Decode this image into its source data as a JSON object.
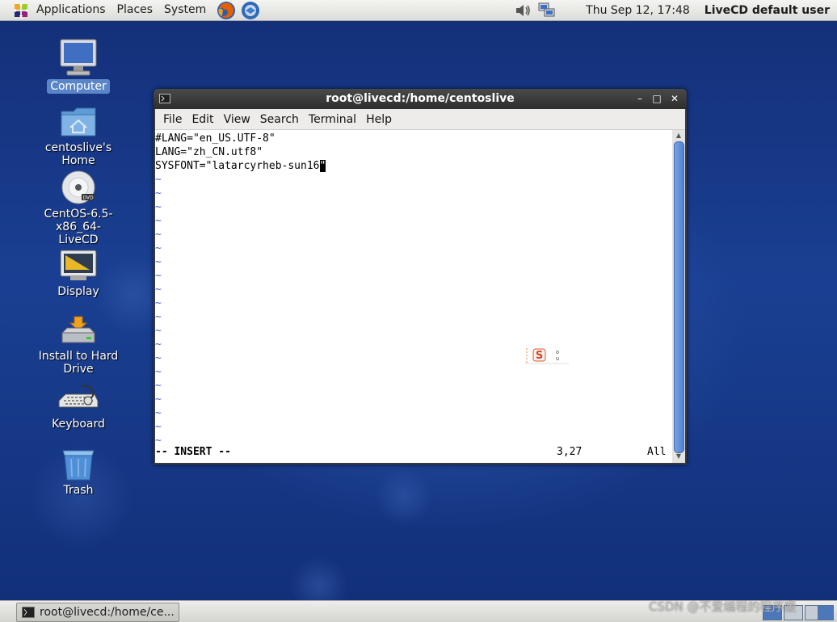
{
  "top_panel": {
    "menus": [
      "Applications",
      "Places",
      "System"
    ],
    "clock": "Thu Sep 12, 17:48",
    "user": "LiveCD default user",
    "launchers": [
      "firefox-icon",
      "thunderbird-icon"
    ],
    "tray": [
      "volume-icon",
      "network-icon"
    ]
  },
  "desktop_icons": [
    {
      "label": "Computer",
      "icon": "computer-icon",
      "selected": true
    },
    {
      "label": "centoslive's Home",
      "icon": "home-folder-icon"
    },
    {
      "label": "CentOS-6.5-x86_64-\nLiveCD",
      "label_line1": "CentOS-6.5-x86_64-",
      "label_line2": "LiveCD",
      "icon": "dvd-icon"
    },
    {
      "label": "Display",
      "icon": "display-icon"
    },
    {
      "label": "Install to Hard Drive",
      "icon": "install-drive-icon"
    },
    {
      "label": "Keyboard",
      "icon": "keyboard-icon"
    },
    {
      "label": "Trash",
      "icon": "trash-icon"
    }
  ],
  "terminal": {
    "title": "root@livecd:/home/centoslive",
    "menus": [
      "File",
      "Edit",
      "View",
      "Search",
      "Terminal",
      "Help"
    ],
    "lines": [
      "#LANG=\"en_US.UTF-8\"",
      "LANG=\"zh_CN.utf8\"",
      "SYSFONT=\"latarcyrheb-sun16"
    ],
    "cursor_char": "\"",
    "tilde": "~",
    "tilde_count": 20,
    "mode": "-- INSERT --",
    "position": "3,27",
    "scroll": "All",
    "wm_buttons": {
      "minimize": "–",
      "maximize": "□",
      "close": "✕"
    }
  },
  "bottom_panel": {
    "task": "root@livecd:/home/ce...",
    "watermark": "CSDN @不爱编程的程序媛"
  },
  "colors": {
    "desktop": "#1a3f92",
    "panel": "#e6e6e3",
    "tilde": "#4a6bd8",
    "scrollbar": "#5b8bd4"
  }
}
